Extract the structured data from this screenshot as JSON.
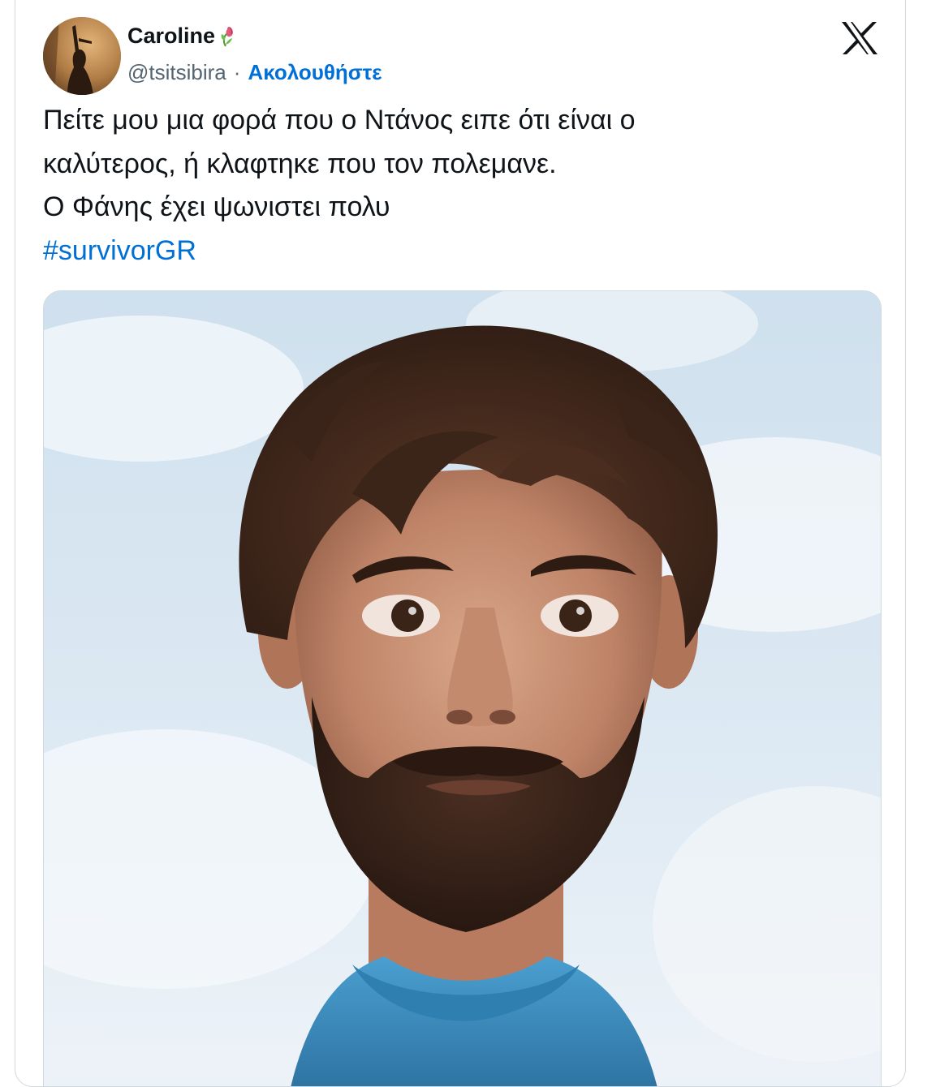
{
  "user": {
    "display_name": "Caroline",
    "name_emoji": "wilted-flower-icon",
    "handle": "@tsitsibira",
    "separator": "·",
    "follow_label": "Ακολουθήστε"
  },
  "platform_logo": "x-logo-icon",
  "tweet": {
    "lines": [
      "Πείτε μου μια φορά που ο Ντάνος ειπε ότι είναι ο",
      "καλύτερος, ή κλαφτηκε που τον πολεμανε.",
      "Ο Φάνης έχει ψωνιστει πολυ"
    ],
    "hashtag": "#survivorGR"
  },
  "media": {
    "alt": "close-up portrait photo of a bearded man with messy hair against a blue sky"
  },
  "colors": {
    "link": "#006fd6",
    "text": "#0f1419",
    "secondary": "#536471",
    "border": "#cfd9de"
  }
}
